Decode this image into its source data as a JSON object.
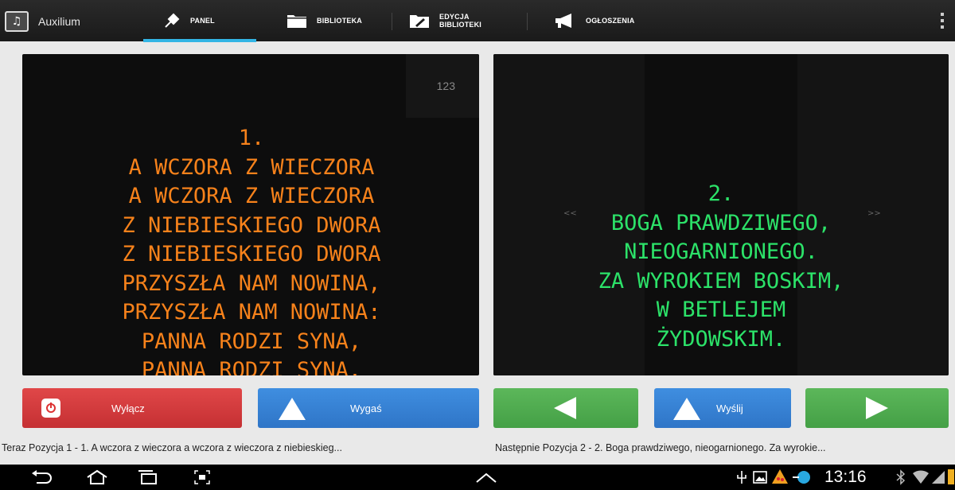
{
  "app": {
    "title": "Auxilium",
    "icon": "music-notes-icon"
  },
  "tabs": [
    {
      "label": "PANEL",
      "icon": "pin-icon",
      "selected": true
    },
    {
      "label": "BIBLIOTEKA",
      "icon": "folder-icon",
      "selected": false
    },
    {
      "label_line1": "EDYCJA",
      "label_line2": "BIBLIOTEKI",
      "icon": "folder-edit-icon",
      "selected": false
    },
    {
      "label": "OGŁOSZENIA",
      "icon": "megaphone-icon",
      "selected": false
    }
  ],
  "overflow_icon": "overflow-menu-icon",
  "current_slide": {
    "counter": "123",
    "lines": "1.\nA WCZORA Z WIECZORA\nA WCZORA Z WIECZORA\nZ NIEBIESKIEGO DWORA\nZ NIEBIESKIEGO DWORA\nPRZYSZŁA NAM NOWINA,\nPRZYSZŁA NAM NOWINA:\nPANNA RODZI SYNA,\nPANNA RODZI SYNA.",
    "color": "#f7821b"
  },
  "next_slide": {
    "lines": "2.\nBOGA PRAWDZIWEGO,\nNIEOGARNIONEGO.\nZA WYROKIEM BOSKIM,\nW BETLEJEM\nŻYDOWSKIM.",
    "prev_arrow": "<<",
    "next_arrow": ">>",
    "color": "#2ce269"
  },
  "buttons": {
    "off_label": "Wyłącz",
    "fade_label": "Wygaś",
    "send_label": "Wyślij"
  },
  "status": {
    "now": "Teraz  Pozycja 1 - 1. A wczora z wieczora a wczora z wieczora z niebieskieg...",
    "next": "Następnie  Pozycja 2 - 2. Boga prawdziwego, nieogarnionego. Za wyrokie..."
  },
  "system_bar": {
    "time": "13:16",
    "colors": {
      "accent": "#33b5e5",
      "red": "#c53033",
      "blue": "#2f75c7",
      "green": "#44a046"
    }
  }
}
